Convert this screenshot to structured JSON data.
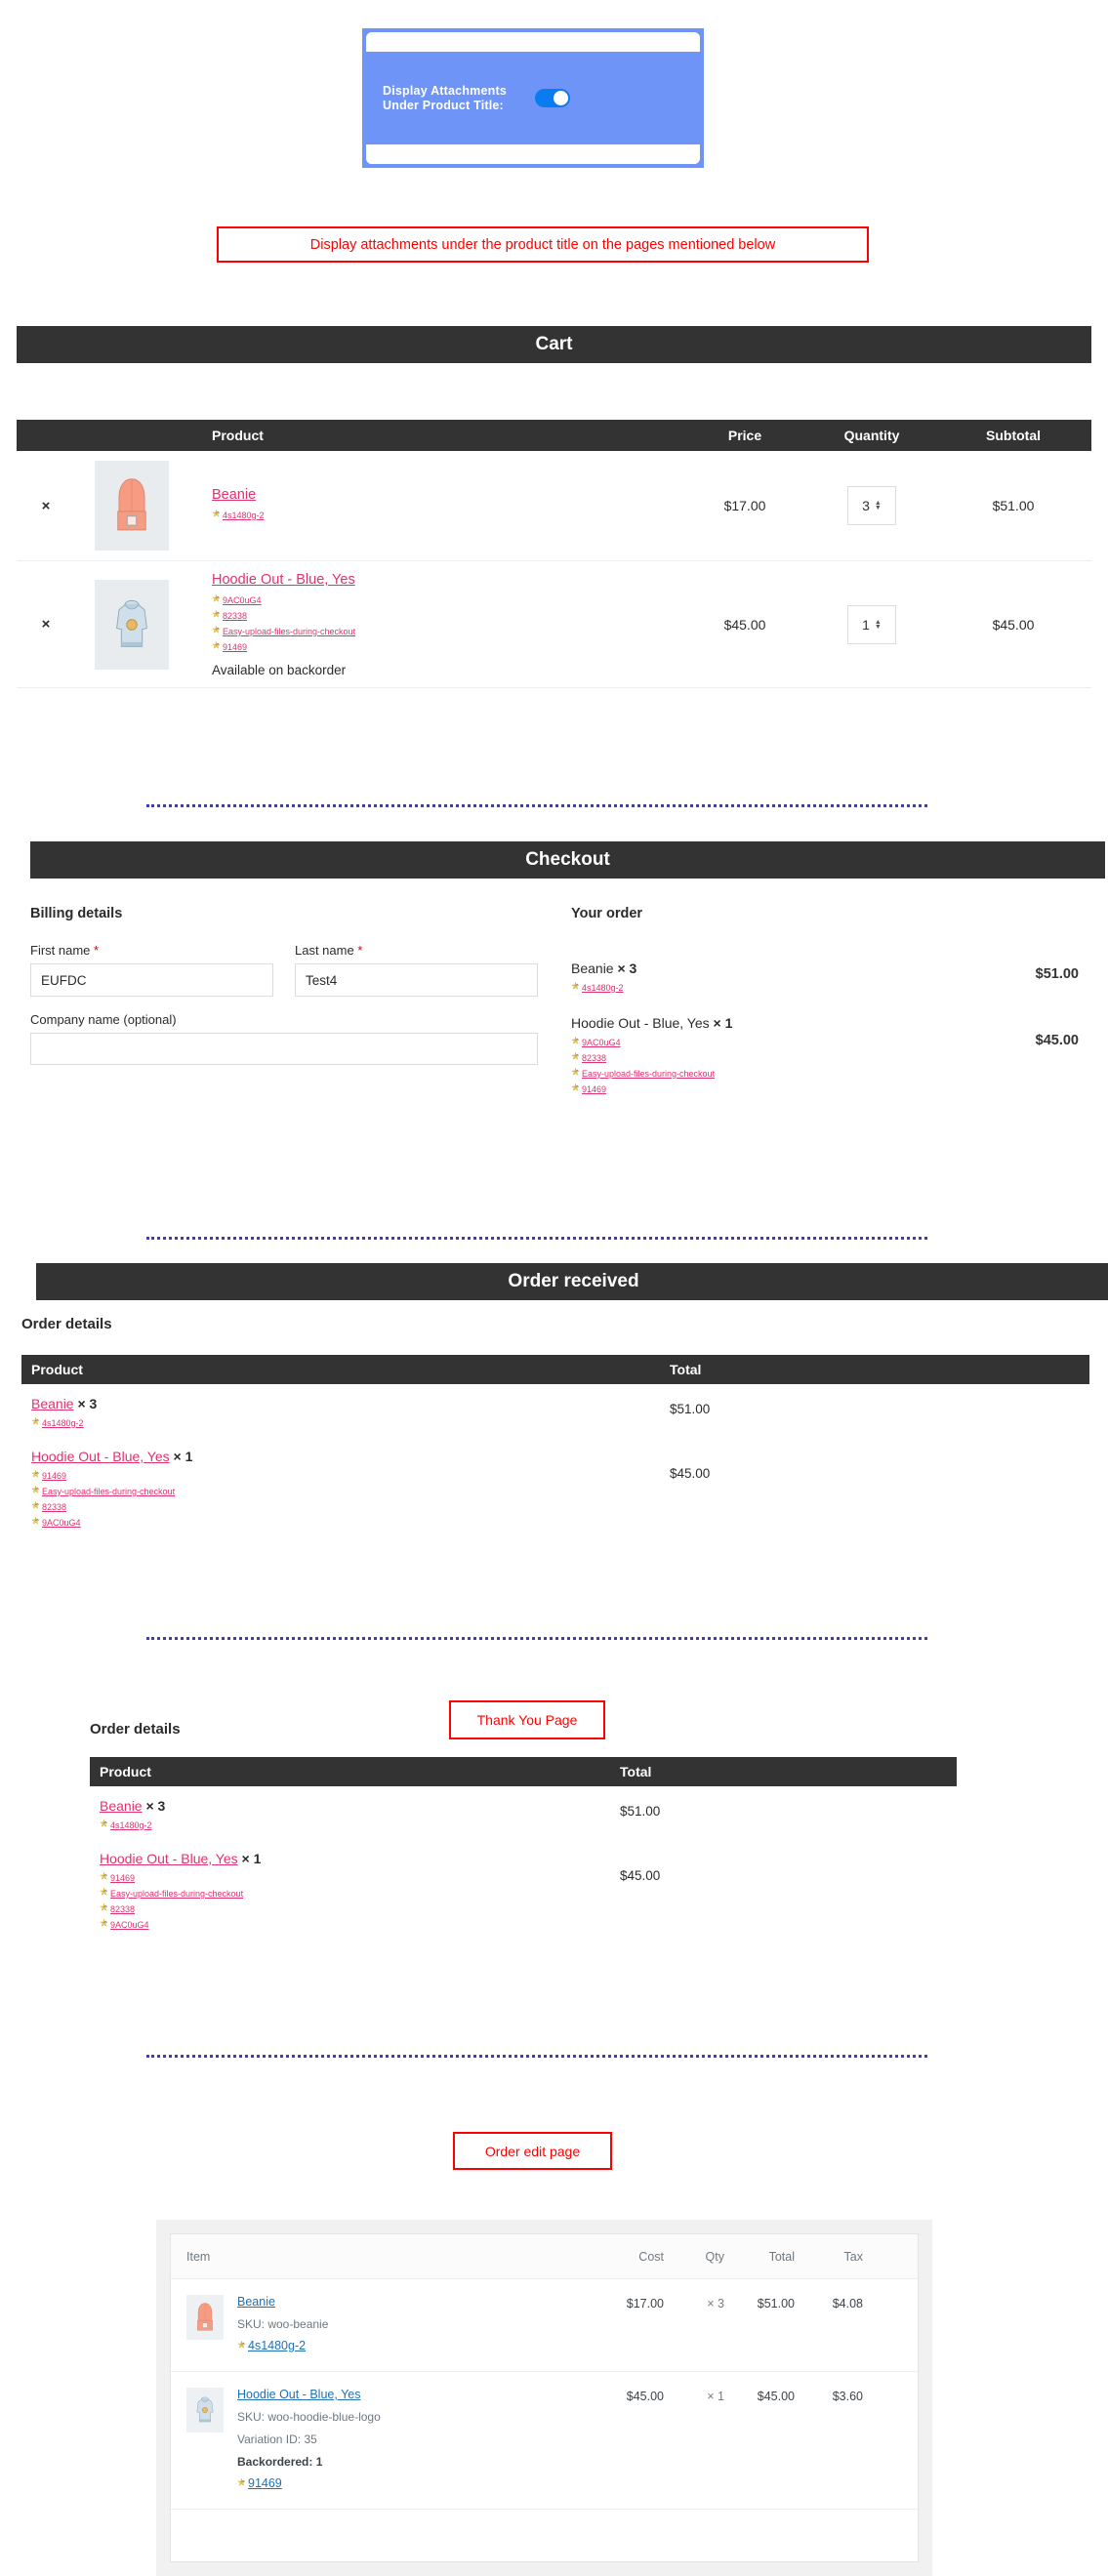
{
  "toggle_card": {
    "label": "Display Attachments\nUnder Product Title:",
    "state": "on",
    "accent_color": "#6e94f7",
    "switch_color": "#0a7cf0"
  },
  "callouts": {
    "main": "Display attachments under the product title on the pages mentioned below",
    "thank_you": "Thank You Page",
    "order_edit": "Order edit page",
    "color": "#ff0000"
  },
  "sections": {
    "cart": "Cart",
    "checkout": "Checkout",
    "order_received": "Order received",
    "bar_bg": "#333333"
  },
  "cart": {
    "columns": {
      "remove": "",
      "thumb": "",
      "product": "Product",
      "price": "Price",
      "quantity": "Quantity",
      "subtotal": "Subtotal"
    },
    "remove_symbol": "×",
    "rows": [
      {
        "name": "Beanie",
        "attachments": [
          "4s1480g-2"
        ],
        "price": "$17.00",
        "quantity": "3",
        "subtotal": "$51.00",
        "stock_note": "",
        "thumb": "beanie-thumbnail"
      },
      {
        "name": "Hoodie Out - Blue, Yes",
        "attachments": [
          "9AC0uG4",
          "82338",
          "Easy-upload-files-during-checkout",
          "91469"
        ],
        "price": "$45.00",
        "quantity": "1",
        "subtotal": "$45.00",
        "stock_note": "Available on backorder",
        "thumb": "hoodie-thumbnail"
      }
    ]
  },
  "checkout": {
    "billing_heading": "Billing details",
    "order_heading": "Your order",
    "fields": [
      {
        "label": "First name",
        "required": true,
        "value": "EUFDC",
        "placeholder": ""
      },
      {
        "label": "Last name",
        "required": true,
        "value": "Test4",
        "placeholder": ""
      },
      {
        "label": "Company name (optional)",
        "required": false,
        "value": "",
        "placeholder": ""
      }
    ],
    "required_mark": "*",
    "order_lines": [
      {
        "name": "Beanie",
        "qty": "× 3",
        "attachments": [
          "4s1480g-2"
        ],
        "total": "$51.00"
      },
      {
        "name": "Hoodie Out - Blue, Yes",
        "qty": "× 1",
        "attachments": [
          "9AC0uG4",
          "82338",
          "Easy-upload-files-during-checkout",
          "91469"
        ],
        "total": "$45.00"
      }
    ]
  },
  "order_received": {
    "details_heading": "Order details",
    "columns": {
      "product": "Product",
      "total": "Total"
    },
    "rows": [
      {
        "name": "Beanie",
        "qty": "× 3",
        "attachments": [
          "4s1480g-2"
        ],
        "total": "$51.00"
      },
      {
        "name": "Hoodie Out - Blue, Yes",
        "qty": "× 1",
        "attachments": [
          "91469",
          "Easy-upload-files-during-checkout",
          "82338",
          "9AC0uG4"
        ],
        "total": "$45.00"
      }
    ]
  },
  "thank_you": {
    "details_heading": "Order details",
    "columns": {
      "product": "Product",
      "total": "Total"
    },
    "rows": [
      {
        "name": "Beanie",
        "qty": "× 3",
        "attachments": [
          "4s1480g-2"
        ],
        "total": "$51.00"
      },
      {
        "name": "Hoodie Out - Blue, Yes",
        "qty": "× 1",
        "attachments": [
          "91469",
          "Easy-upload-files-during-checkout",
          "82338",
          "9AC0uG4"
        ],
        "total": "$45.00"
      }
    ]
  },
  "order_edit": {
    "columns": {
      "item": "Item",
      "cost": "Cost",
      "qty": "Qty",
      "total": "Total",
      "tax": "Tax"
    },
    "rows": [
      {
        "name": "Beanie",
        "sku": "SKU: woo-beanie",
        "variation": "",
        "backordered": "",
        "attachments": [
          "4s1480g-2"
        ],
        "cost": "$17.00",
        "qty": "× 3",
        "total": "$51.00",
        "tax": "$4.08",
        "thumb": "beanie-thumbnail"
      },
      {
        "name": "Hoodie Out - Blue, Yes",
        "sku": "SKU: woo-hoodie-blue-logo",
        "variation": "Variation ID: 35",
        "backordered": "Backordered: 1",
        "attachments": [
          "91469"
        ],
        "cost": "$45.00",
        "qty": "× 1",
        "total": "$45.00",
        "tax": "$3.60",
        "thumb": "hoodie-thumbnail"
      }
    ]
  },
  "icons": {
    "attachment": "attachment-icon",
    "spinner_up": "▲",
    "spinner_down": "▼"
  }
}
